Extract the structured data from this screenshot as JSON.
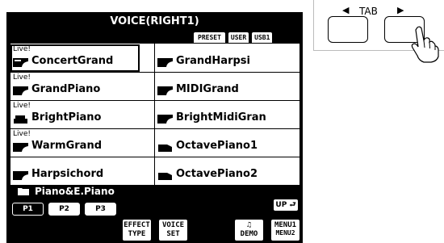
{
  "screen": {
    "title": "VOICE(RIGHT1)",
    "tabs": [
      "PRESET",
      "USER",
      "USB1"
    ],
    "voices": [
      {
        "name": "ConcertGrand",
        "live": "Live!",
        "selected": true
      },
      {
        "name": "GrandHarpsi",
        "live": "",
        "selected": false
      },
      {
        "name": "GrandPiano",
        "live": "Live!",
        "selected": false
      },
      {
        "name": "MIDIGrand",
        "live": "",
        "selected": false
      },
      {
        "name": "BrightPiano",
        "live": "Live!",
        "selected": false
      },
      {
        "name": "BrightMidiGran",
        "live": "",
        "selected": false
      },
      {
        "name": "WarmGrand",
        "live": "Live!",
        "selected": false
      },
      {
        "name": "OctavePiano1",
        "live": "",
        "selected": false
      },
      {
        "name": "Harpsichord",
        "live": "",
        "selected": false
      },
      {
        "name": "OctavePiano2",
        "live": "",
        "selected": false
      }
    ],
    "category": "Piano&E.Piano",
    "pages": [
      "P1",
      "P2",
      "P3"
    ],
    "up_label": "UP",
    "effect_type": [
      "EFFECT",
      "TYPE"
    ],
    "voice_set": [
      "VOICE",
      "SET"
    ],
    "demo": "DEMO",
    "menu1": "MENU1",
    "menu2": "MENU2"
  },
  "panel": {
    "tab_label": "TAB",
    "left_arrow": "◀",
    "right_arrow": "▶"
  }
}
